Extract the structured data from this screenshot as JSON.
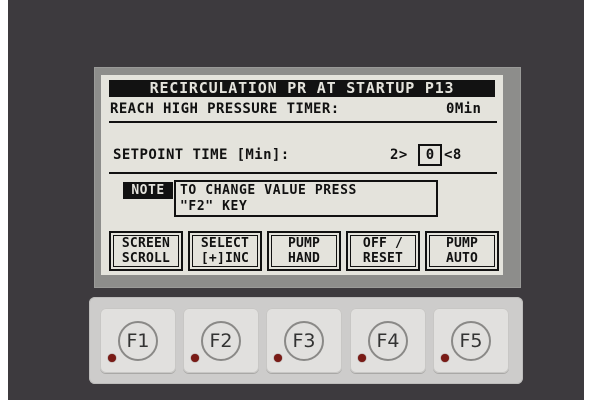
{
  "screen": {
    "title": "RECIRCULATION PR AT STARTUP P13",
    "timer_label": "REACH HIGH PRESSURE TIMER:",
    "timer_value": "0Min",
    "setpoint_label": "SETPOINT TIME [Min]:",
    "setpoint_min_prefix": "2>",
    "setpoint_value": "0",
    "setpoint_max_suffix": "<8",
    "note_tag": "NOTE",
    "note_line1": "TO CHANGE VALUE PRESS",
    "note_line2": "\"F2\" KEY"
  },
  "soft_keys": [
    {
      "line1": "SCREEN",
      "line2": "SCROLL"
    },
    {
      "line1": "SELECT",
      "line2": "[+]INC"
    },
    {
      "line1": "PUMP",
      "line2": "HAND"
    },
    {
      "line1": "OFF /",
      "line2": "RESET"
    },
    {
      "line1": "PUMP",
      "line2": "AUTO"
    }
  ],
  "function_keys": [
    "F1",
    "F2",
    "F3",
    "F4",
    "F5"
  ],
  "colors": {
    "panel": "#3d3a3e",
    "lcd_background": "#e4e3dc",
    "lcd_ink": "#111111",
    "keypad": "#cdcccb",
    "led": "#7a1b16"
  }
}
